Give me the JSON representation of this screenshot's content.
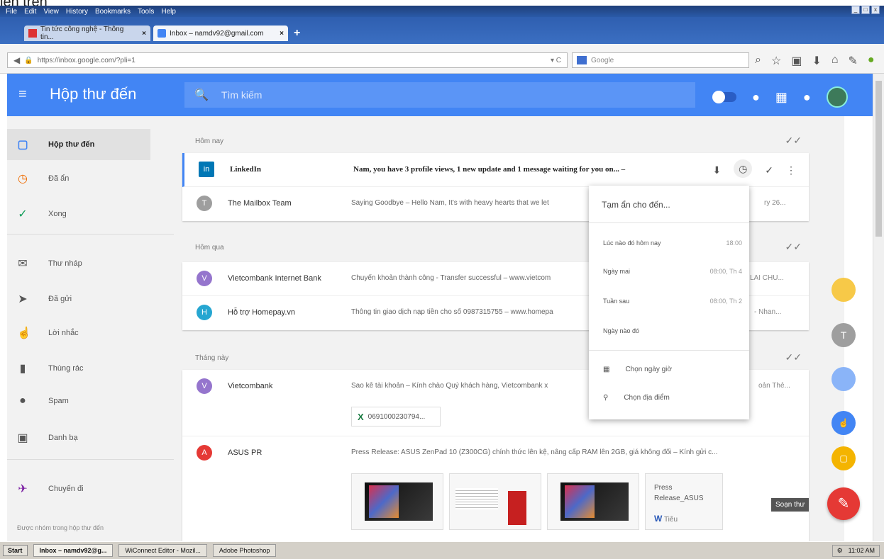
{
  "caption": "lên trên",
  "browser": {
    "menu": [
      "File",
      "Edit",
      "View",
      "History",
      "Bookmarks",
      "Tools",
      "Help"
    ],
    "tabs": [
      {
        "label": "Tin tức công nghệ - Thông tin..."
      },
      {
        "label": "Inbox – namdv92@gmail.com"
      }
    ],
    "new_tab": "+",
    "url": "https://inbox.google.com/?pli=1",
    "search_placeholder": "Google"
  },
  "app": {
    "title": "Hộp thư đến",
    "search_placeholder": "Tìm kiếm"
  },
  "sidebar": {
    "items": [
      {
        "label": "Hộp thư đến",
        "icon": "inbox-icon"
      },
      {
        "label": "Đã ẩn",
        "icon": "clock-icon"
      },
      {
        "label": "Xong",
        "icon": "check-icon"
      },
      {
        "label": "Thư nháp",
        "icon": "draft-icon"
      },
      {
        "label": "Đã gửi",
        "icon": "send-icon"
      },
      {
        "label": "Lời nhắc",
        "icon": "reminder-icon"
      },
      {
        "label": "Thùng rác",
        "icon": "trash-icon"
      },
      {
        "label": "Spam",
        "icon": "spam-icon"
      },
      {
        "label": "Danh bạ",
        "icon": "contacts-icon"
      },
      {
        "label": "Chuyến đi",
        "icon": "plane-icon"
      }
    ],
    "footer": "Được nhóm trong hộp thư đến"
  },
  "sections": {
    "today": "Hôm nay",
    "yesterday": "Hôm qua",
    "this_month": "Tháng này"
  },
  "emails": {
    "linkedin": {
      "sender": "LinkedIn",
      "snippet": "Nam, you have 3 profile views, 1 new update and 1 message waiting for you on... –"
    },
    "mailbox": {
      "sender": "The Mailbox Team",
      "snippet": "Saying Goodbye – Hello Nam, It's with heavy hearts that we let",
      "date": "ry 26..."
    },
    "vcb_ib": {
      "sender": "Vietcombank Internet Bank",
      "snippet": "Chuyển khoản thành công - Transfer successful – www.vietcom",
      "date": "LAI CHU..."
    },
    "homepay": {
      "sender": "Hỗ trợ Homepay.vn",
      "snippet": "Thông tin giao dịch nạp tiền cho số 0987315755 – www.homepa",
      "date": "- Nhan..."
    },
    "vcb": {
      "sender": "Vietcombank",
      "snippet": "Sao kê tài khoản – Kính chào Quý khách hàng, Vietcombank x",
      "date": "oản Thẻ...",
      "attachment": "0691000230794..."
    },
    "asus": {
      "sender": "ASUS PR",
      "snippet": "Press Release: ASUS ZenPad 10 (Z300CG) chính thức lên kệ, nâng cấp RAM lên 2GB, giá không đổi – Kính gửi c...",
      "attachment_title": "Press Release_ASUS",
      "attachment_type": "Tiêu"
    }
  },
  "snooze_menu": {
    "title": "Tạm ẩn cho đến...",
    "options": [
      {
        "label": "Lúc nào đó hôm nay",
        "time": "18:00"
      },
      {
        "label": "Ngày mai",
        "time": "08:00, Th 4"
      },
      {
        "label": "Tuần sau",
        "time": "08:00, Th 2"
      },
      {
        "label": "Ngày nào đó",
        "time": ""
      }
    ],
    "pick_date": "Chọn ngày giờ",
    "pick_place": "Chọn địa điểm"
  },
  "compose_tooltip": "Soạn thư",
  "taskbar": {
    "start": "Start",
    "tasks": [
      "Inbox – namdv92@g...",
      "WiConnect Editor - Mozil...",
      "Adobe Photoshop"
    ],
    "clock": "11:02 AM"
  },
  "colors": {
    "accent": "#4285f4",
    "compose": "#e53935"
  }
}
